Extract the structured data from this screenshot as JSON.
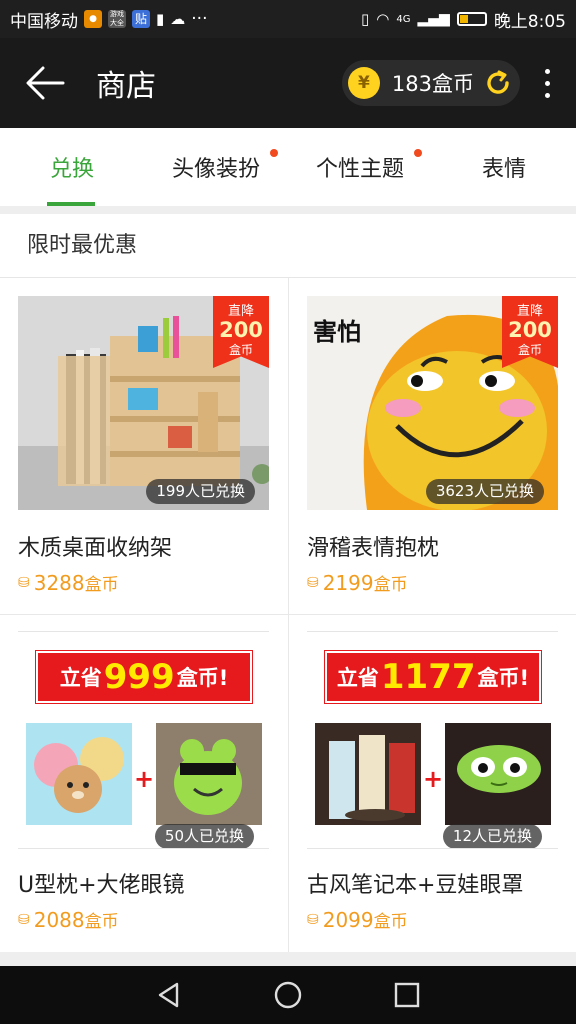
{
  "status_bar": {
    "carrier": "中国移动",
    "time": "晚上8:05",
    "app_icon_1": "游戏大全",
    "app_icon_2": "贴",
    "network": "4G"
  },
  "header": {
    "title": "商店",
    "coin_balance": "183盒币",
    "coin_symbol": "¥"
  },
  "tabs": [
    {
      "label": "兑换",
      "active": true,
      "dot": false
    },
    {
      "label": "头像装扮",
      "active": false,
      "dot": true
    },
    {
      "label": "个性主题",
      "active": false,
      "dot": true
    },
    {
      "label": "表情",
      "active": false,
      "dot": false
    }
  ],
  "section": {
    "title": "限时最优惠"
  },
  "products": [
    {
      "name": "木质桌面收纳架",
      "price": "3288",
      "price_unit": "盒币",
      "sold": "199人已兑换",
      "ribbon": {
        "line1": "直降",
        "line2": "200",
        "line3": "盒币"
      }
    },
    {
      "name": "滑稽表情抱枕",
      "price": "2199",
      "price_unit": "盒币",
      "sold": "3623人已兑换",
      "ribbon": {
        "line1": "直降",
        "line2": "200",
        "line3": "盒币"
      },
      "image_text": "害怕"
    },
    {
      "name": "U型枕+大佬眼镜",
      "price": "2088",
      "price_unit": "盒币",
      "sold": "50人已兑换",
      "banner": {
        "prefix": "立省",
        "amount": "999",
        "suffix": "盒币!"
      }
    },
    {
      "name": "古风笔记本+豆娃眼罩",
      "price": "2099",
      "price_unit": "盒币",
      "sold": "12人已兑换",
      "banner": {
        "prefix": "立省",
        "amount": "1177",
        "suffix": "盒币!"
      }
    }
  ],
  "colors": {
    "accent_green": "#3aa53a",
    "price_orange": "#f29c1f",
    "ribbon_red": "#f0311a",
    "header_bg": "#1a1a1a"
  }
}
